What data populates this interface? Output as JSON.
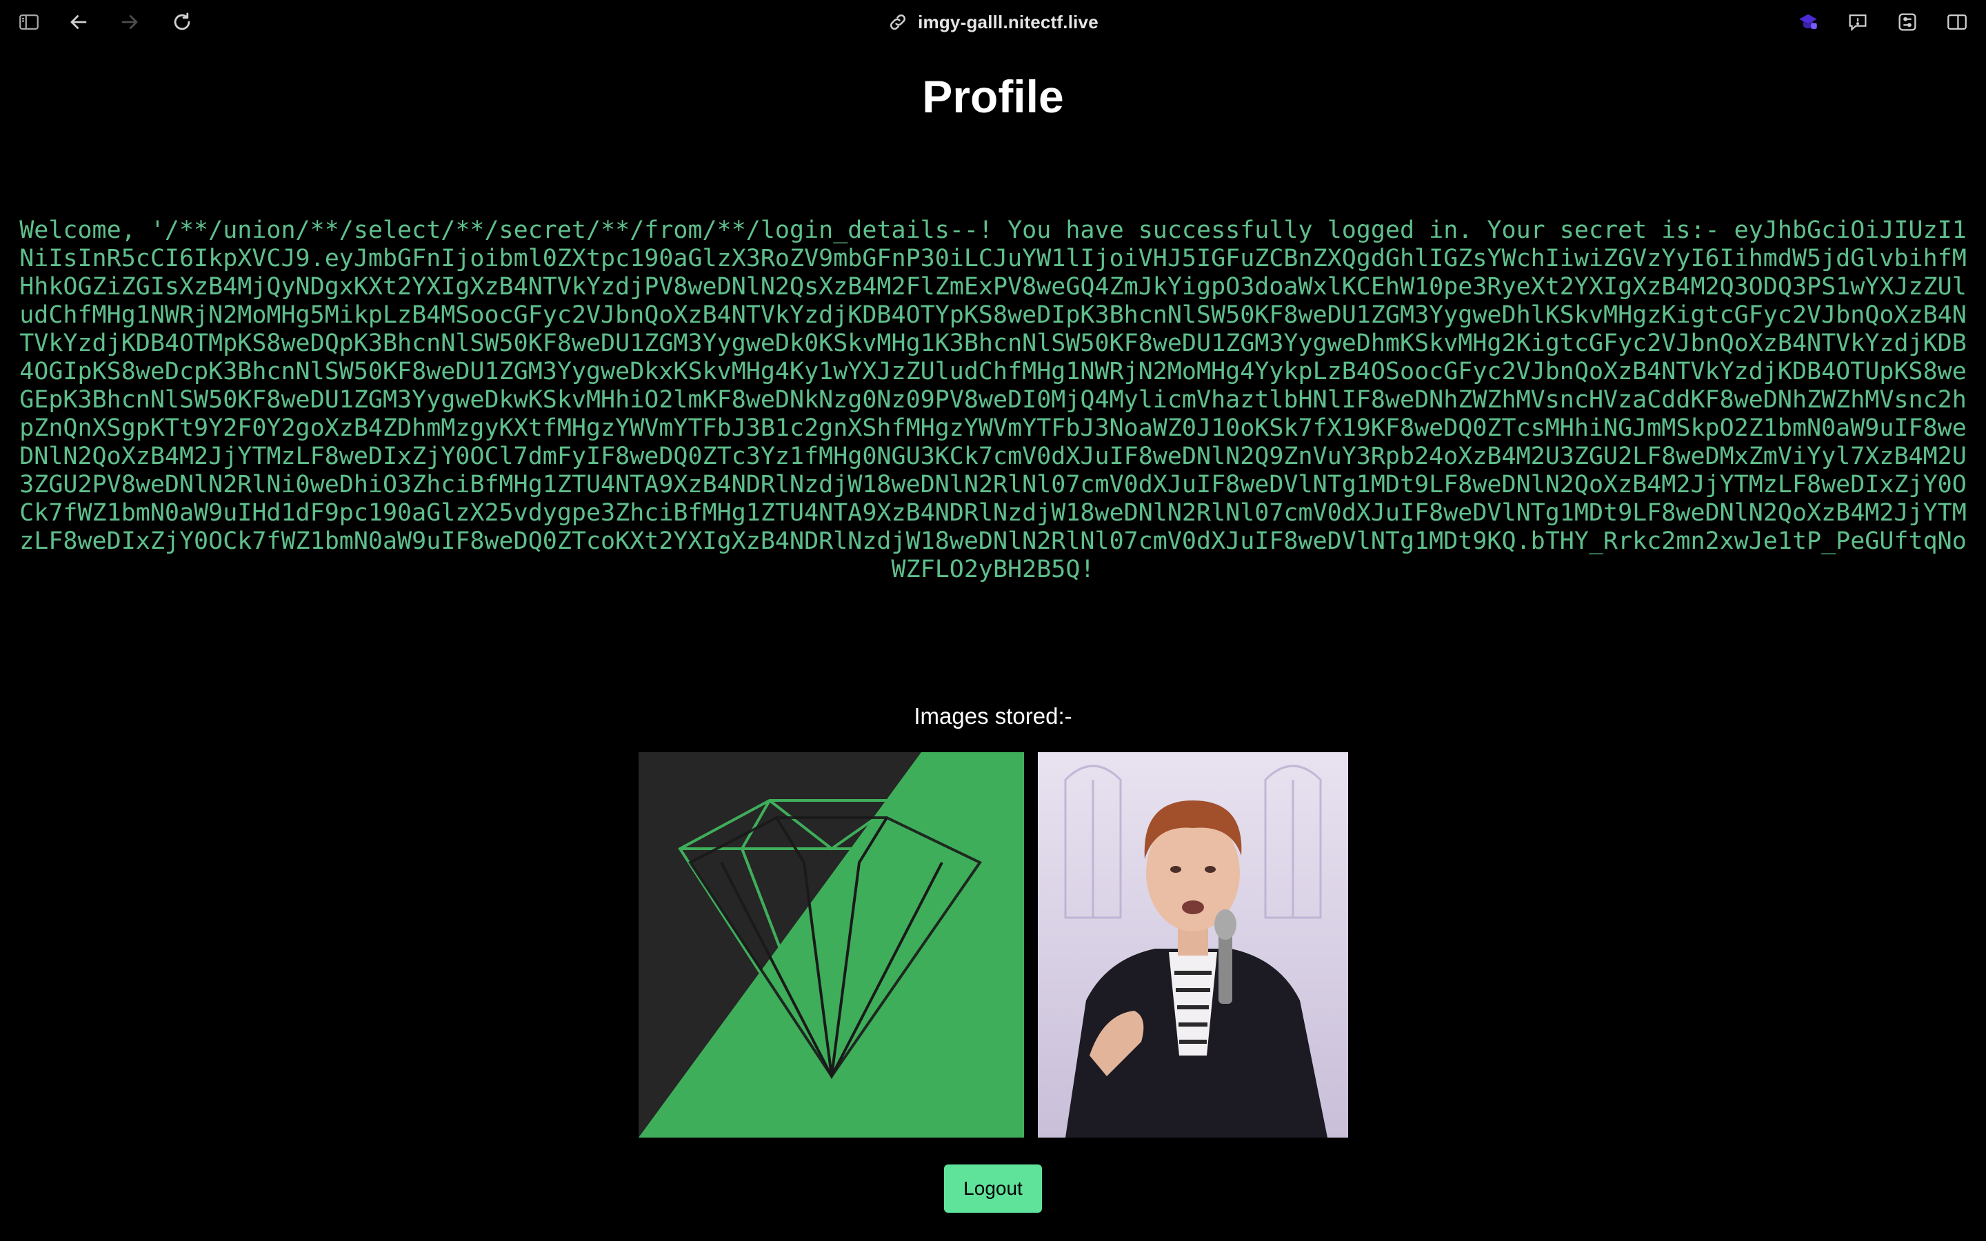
{
  "browser": {
    "url": "imgy-galll.nitectf.live",
    "icons": [
      "sidebar-icon",
      "back-icon",
      "forward-icon",
      "reload-icon",
      "link-icon",
      "extension-icon",
      "feedback-icon",
      "tabs-icon",
      "split-view-icon"
    ]
  },
  "page": {
    "title": "Profile",
    "welcome_text": "Welcome, '/**/union/**/select/**/secret/**/from/**/login_details--! You have successfully logged in. Your secret is:- eyJhbGciOiJIUzI1NiIsInR5cCI6IkpXVCJ9.eyJmbGFnIjoibml0ZXtpc190aGlzX3RoZV9mbGFnP30iLCJuYW1lIjoiVHJ5IGFuZCBnZXQgdGhlIGZsYWchIiwiZGVzYyI6IihmdW5jdGlvbihfMHhkOGZiZGIsXzB4MjQyNDgxKXt2YXIgXzB4NTVkYzdjPV8weDNlN2QsXzB4M2FlZmExPV8weGQ4ZmJkYigpO3doaWxlKCEhW10pe3RyeXt2YXIgXzB4M2Q3ODQ3PS1wYXJzZUludChfMHg1NWRjN2MoMHg5MikpLzB4MSoocGFyc2VJbnQoXzB4NTVkYzdjKDB4OTYpKS8weDIpK3BhcnNlSW50KF8weDU1ZGM3YygweDhlKSkvMHgzKigtcGFyc2VJbnQoXzB4NTVkYzdjKDB4OTMpKS8weDQpK3BhcnNlSW50KF8weDU1ZGM3YygweDk0KSkvMHg1K3BhcnNlSW50KF8weDU1ZGM3YygweDhmKSkvMHg2KigtcGFyc2VJbnQoXzB4NTVkYzdjKDB4OGIpKS8weDcpK3BhcnNlSW50KF8weDU1ZGM3YygweDkxKSkvMHg4Ky1wYXJzZUludChfMHg1NWRjN2MoMHg4YykpLzB4OSoocGFyc2VJbnQoXzB4NTVkYzdjKDB4OTUpKS8weGEpK3BhcnNlSW50KF8weDU1ZGM3YygweDkwKSkvMHhiO2lmKF8weDNkNzg0Nz09PV8weDI0MjQ4MylicmVhaztlbHNlIF8weDNhZWZhMVsncHVzaCddKF8weDNhZWZhMVsnc2hpZnQnXSgpKTt9Y2F0Y2goXzB4ZDhmMzgyKXtfMHgzYWVmYTFbJ3B1c2gnXShfMHgzYWVmYTFbJ3NoaWZ0J10oKSk7fX19KF8weDQ0ZTcsMHhiNGJmMSkpO2Z1bmN0aW9uIF8weDNlN2QoXzB4M2JjYTMzLF8weDIxZjY0OCl7dmFyIF8weDQ0ZTc3Yz1fMHg0NGU3KCk7cmV0dXJuIF8weDNlN2Q9ZnVuY3Rpb24oXzB4M2U3ZGU2LF8weDMxZmViYyl7XzB4M2U3ZGU2PV8weDNlN2RlNi0weDhiO3ZhciBfMHg1ZTU4NTA9XzB4NDRlNzdjW18weDNlN2RlNl07cmV0dXJuIF8weDVlNTg1MDt9LF8weDNlN2QoXzB4M2JjYTMzLF8weDIxZjY0OCk7fWZ1bmN0aW9uIHd1dF9pc190aGlzX25vdygpe3ZhciBfMHg1ZTU4NTA9XzB4NDRlNzdjW18weDNlN2RlNl07cmV0dXJuIF8weDVlNTg1MDt9LF8weDNlN2QoXzB4M2JjYTMzLF8weDIxZjY0OCk7fWZ1bmN0aW9uIF8weDQ0ZTcoKXt2YXIgXzB4NDRlNzdjW18weDNlN2RlNl07cmV0dXJuIF8weDVlNTg1MDt9KQ.bTHY_Rrkc2mn2xwJe1tP_PeGUftqNoWZFLO2yBH2B5Q!",
    "images_label": "Images stored:-",
    "images": [
      {
        "name": "green diamond logo",
        "accent": "#3fae5a"
      },
      {
        "name": "man singing at microphone",
        "accent": "#d9d2e6"
      }
    ],
    "logout_label": "Logout"
  },
  "colors": {
    "background": "#000000",
    "secret_text": "#5fbf8c",
    "logout_button": "#5fe39b"
  }
}
